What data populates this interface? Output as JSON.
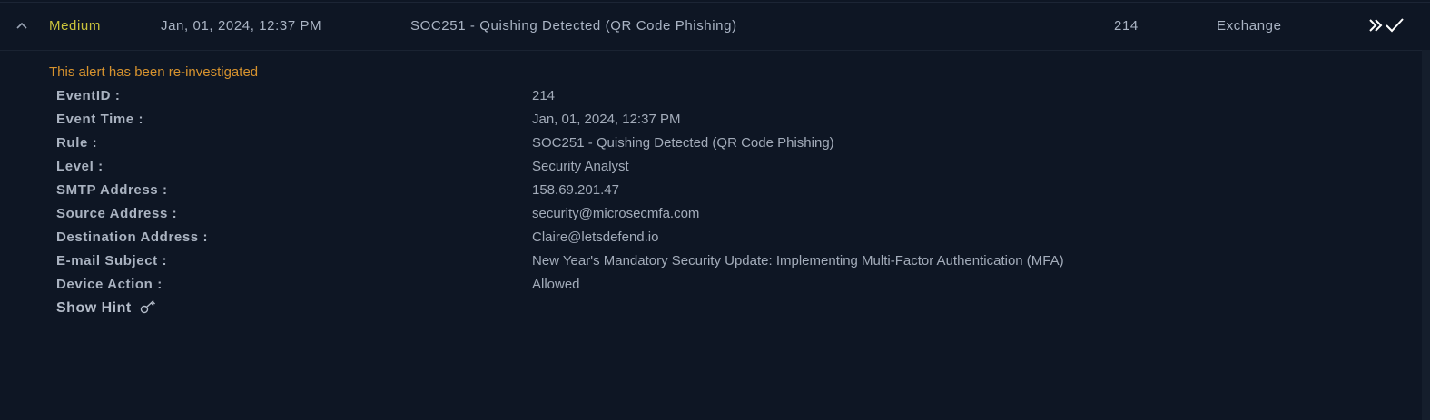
{
  "alert": {
    "level": "Medium",
    "time": "Jan, 01, 2024, 12:37 PM",
    "rule": "SOC251 - Quishing Detected (QR Code Phishing)",
    "event_id": "214",
    "source": "Exchange"
  },
  "icons": {
    "collapse": "chevron-up-icon",
    "forward": "double-chevron-right-icon",
    "close": "checkmark-icon",
    "hint": "key-icon"
  },
  "colors": {
    "background": "#0e1624",
    "level_medium": "#c9c23b",
    "reinvestigated": "#d6922e"
  },
  "notice": "This alert has been re-investigated",
  "details": [
    {
      "label": "EventID :",
      "value": "214"
    },
    {
      "label": "Event Time :",
      "value": "Jan, 01, 2024, 12:37 PM"
    },
    {
      "label": "Rule :",
      "value": "SOC251 - Quishing Detected (QR Code Phishing)"
    },
    {
      "label": "Level :",
      "value": "Security Analyst"
    },
    {
      "label": "SMTP Address :",
      "value": "158.69.201.47"
    },
    {
      "label": "Source Address :",
      "value": "security@microsecmfa.com"
    },
    {
      "label": "Destination Address :",
      "value": "Claire@letsdefend.io"
    },
    {
      "label": "E-mail Subject :",
      "value": "New Year's Mandatory Security Update: Implementing Multi-Factor Authentication (MFA)"
    },
    {
      "label": "Device Action :",
      "value": "Allowed"
    }
  ],
  "hint_label": "Show Hint"
}
